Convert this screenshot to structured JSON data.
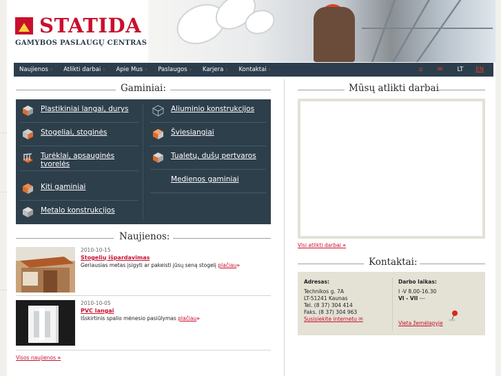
{
  "brand": {
    "name": "STATIDA",
    "subtitle": "GAMYBOS PASLAUGŲ CENTRAS",
    "color": "#c8102e"
  },
  "nav": {
    "items": [
      {
        "label": "Naujienos",
        "arrow": "›"
      },
      {
        "label": "Atlikti darbai",
        "arrow": "›"
      },
      {
        "label": "Apie Mus",
        "arrow": "›"
      },
      {
        "label": "Paslaugos",
        "arrow": "›"
      },
      {
        "label": "Karjera",
        "arrow": "›"
      },
      {
        "label": "Kontaktai",
        "arrow": "›"
      }
    ],
    "home_icon": "⌂",
    "mail_icon": "✉",
    "languages": [
      {
        "code": "LT",
        "active": false
      },
      {
        "code": "EN",
        "active": true
      }
    ],
    "bg_color": "#2c3e4d",
    "accent_color": "#e0441e"
  },
  "products": {
    "heading": "Gaminiai:",
    "left": [
      {
        "label": "Plastikiniai langai, durys",
        "icon": "cube-grey-orange-icon"
      },
      {
        "label": "Stogeliai, stoginės",
        "icon": "cube-grey-orange-icon"
      },
      {
        "label": "Turėklai, apsauginės tvorelės",
        "icon": "railing-cube-icon"
      },
      {
        "label": "Kiti gaminiai",
        "icon": "cube-orange-icon"
      },
      {
        "label": "Metalo konstrukcijos",
        "icon": "cube-grey-icon"
      }
    ],
    "right": [
      {
        "label": "Aliuminio konstrukcijos",
        "icon": "cube-outline-icon"
      },
      {
        "label": "Šviesiangiai",
        "icon": "cube-orange-icon"
      },
      {
        "label": "Tualetų, dušų pertvaros",
        "icon": "cube-grey-orange-icon"
      },
      {
        "label": "Medienos gaminiai",
        "icon": ""
      }
    ]
  },
  "news": {
    "heading": "Naujienos:",
    "items": [
      {
        "date": "2010-10-15",
        "title": "Stogelių išpardavimas",
        "text": "Geriausias metas įsigyti ar pakeisti jūsų seną stogelį",
        "more": "plačiau",
        "arrow": "»"
      },
      {
        "date": "2010-10-05",
        "title": "PVC langai",
        "text": "Išskirtinis spalio mėnesio pasiūlymas",
        "more": "plačiau",
        "arrow": "»"
      }
    ],
    "all_link": "Visos naujienos",
    "all_arrow": "»"
  },
  "works": {
    "heading": "Mūsų atlikti darbai",
    "all_link": "Visi atlikti darbai",
    "all_arrow": "»"
  },
  "contacts": {
    "heading": "Kontaktai:",
    "address_heading": "Adresas:",
    "address_lines": [
      "Technikos g. 7A",
      "LT-51241 Kaunas",
      "Tel. (8 37) 304 414",
      "Faks. (8 37) 304 963"
    ],
    "contact_link": "Susisiekite internetu",
    "hours_heading": "Darbo laikas:",
    "hours_weekdays": "I -V 8.00-16.30",
    "hours_weekend_days": "VI - VII",
    "hours_weekend_value": " ---",
    "map_link": "Vieta žemėlapyje"
  }
}
